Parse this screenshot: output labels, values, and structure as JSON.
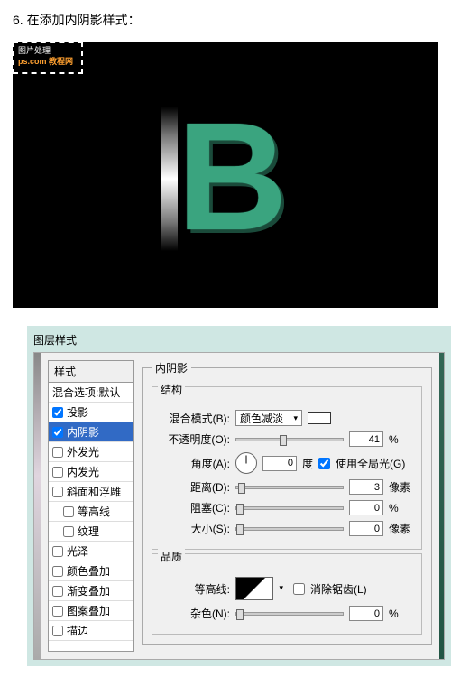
{
  "step_title": "6. 在添加内阴影样式：",
  "watermark": {
    "line1": "图片处理",
    "line2": "ps.com 教程网"
  },
  "letter": "B",
  "dialog": {
    "title": "图层样式",
    "styles_header": "样式",
    "style_items": [
      {
        "label": "混合选项:默认",
        "checkbox": false,
        "checked": false,
        "indent": false
      },
      {
        "label": "投影",
        "checkbox": true,
        "checked": true,
        "indent": false
      },
      {
        "label": "内阴影",
        "checkbox": true,
        "checked": true,
        "indent": false,
        "selected": true
      },
      {
        "label": "外发光",
        "checkbox": true,
        "checked": false,
        "indent": false
      },
      {
        "label": "内发光",
        "checkbox": true,
        "checked": false,
        "indent": false
      },
      {
        "label": "斜面和浮雕",
        "checkbox": true,
        "checked": false,
        "indent": false
      },
      {
        "label": "等高线",
        "checkbox": true,
        "checked": false,
        "indent": true
      },
      {
        "label": "纹理",
        "checkbox": true,
        "checked": false,
        "indent": true
      },
      {
        "label": "光泽",
        "checkbox": true,
        "checked": false,
        "indent": false
      },
      {
        "label": "颜色叠加",
        "checkbox": true,
        "checked": false,
        "indent": false
      },
      {
        "label": "渐变叠加",
        "checkbox": true,
        "checked": false,
        "indent": false
      },
      {
        "label": "图案叠加",
        "checkbox": true,
        "checked": false,
        "indent": false
      },
      {
        "label": "描边",
        "checkbox": true,
        "checked": false,
        "indent": false
      }
    ],
    "panel_title": "内阴影",
    "structure_title": "结构",
    "blend_mode_label": "混合模式(B):",
    "blend_mode_value": "颜色减淡",
    "opacity_label": "不透明度(O):",
    "opacity_value": "41",
    "percent": "%",
    "angle_label": "角度(A):",
    "angle_value": "0",
    "angle_unit": "度",
    "global_light_label": "使用全局光(G)",
    "global_light_checked": true,
    "distance_label": "距离(D):",
    "distance_value": "3",
    "choke_label": "阻塞(C):",
    "choke_value": "0",
    "size_label": "大小(S):",
    "size_value": "0",
    "px_unit": "像素",
    "quality_title": "品质",
    "contour_label": "等高线:",
    "antialias_label": "消除锯齿(L)",
    "antialias_checked": false,
    "noise_label": "杂色(N):",
    "noise_value": "0"
  }
}
